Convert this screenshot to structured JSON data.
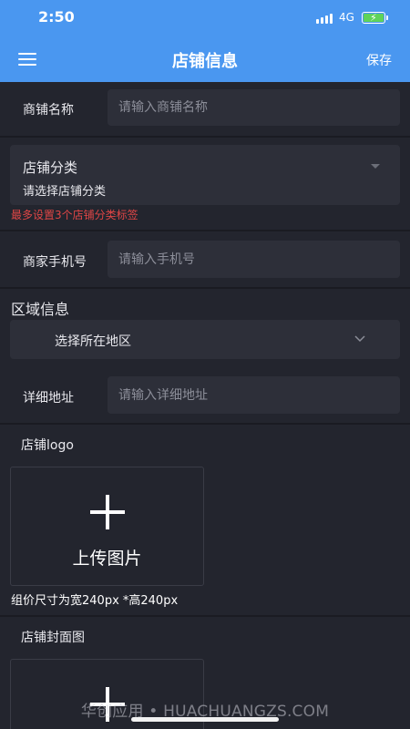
{
  "status_bar": {
    "time": "2:50",
    "network": "4G"
  },
  "nav": {
    "title": "店铺信息",
    "save_label": "保存"
  },
  "form": {
    "shop_name": {
      "label": "商铺名称",
      "placeholder": "请输入商铺名称"
    },
    "category": {
      "label": "店铺分类",
      "value": "请选择店铺分类",
      "hint": "最多设置3个店铺分类标签"
    },
    "phone": {
      "label": "商家手机号",
      "placeholder": "请输入手机号"
    },
    "region": {
      "section_title": "区域信息",
      "value": "选择所在地区"
    },
    "address": {
      "label": "详细地址",
      "placeholder": "请输入详细地址"
    },
    "logo": {
      "title": "店铺logo",
      "upload_label": "上传图片",
      "size_note": "组价尺寸为宽240px *高240px"
    },
    "cover": {
      "title": "店铺封面图"
    }
  },
  "watermark": "华创应用 • HUACHUANGZS.COM",
  "colors": {
    "header": "#4a97f0",
    "background": "#23252e",
    "field": "#2d2f39",
    "hint": "#e04646"
  }
}
